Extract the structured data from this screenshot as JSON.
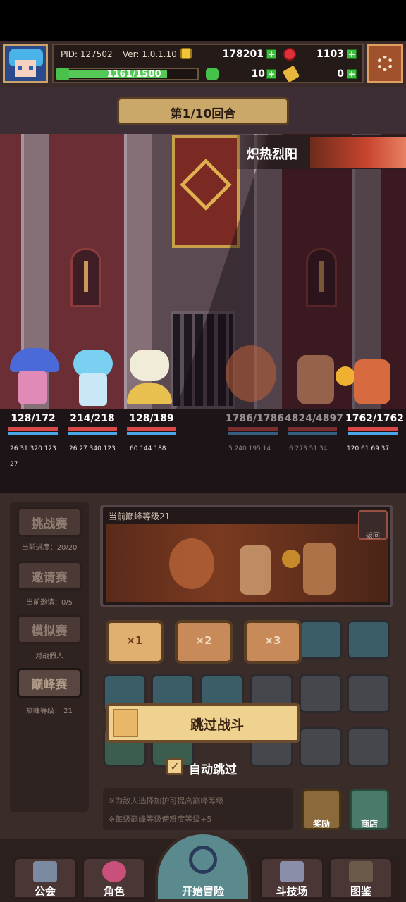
{
  "hud": {
    "pid": "PID: 127502",
    "version": "Ver: 1.0.1.10",
    "gold": "178201",
    "gems": "1103",
    "stamina": "1161/1500",
    "stamina_ratio": 0.774,
    "clover": "10",
    "keys": "0"
  },
  "battle": {
    "round": "第1/10回合",
    "boss_name": "炽热烈阳",
    "heroes": [
      {
        "hp": "128/172",
        "stats": "26 31 320 123",
        "extra": "27"
      },
      {
        "hp": "214/218",
        "stats": "26 27 340 123"
      },
      {
        "hp": "128/189",
        "stats": "60 144 188"
      }
    ],
    "enemies": [
      {
        "hp": "1786/1786",
        "stats": "5 240 195 14"
      },
      {
        "hp": "4824/4897",
        "stats": "6 273 51 34"
      },
      {
        "hp": "1762/1762",
        "stats": "120 61 69 37"
      }
    ]
  },
  "sidebar": {
    "items": [
      {
        "label": "挑战赛",
        "sub": "当前进度：20/20"
      },
      {
        "label": "邀请赛",
        "sub": "当前邀请：0/5"
      },
      {
        "label": "模拟赛",
        "sub": "对战假人"
      },
      {
        "label": "巅峰赛",
        "sub": "巅峰等级： 21"
      }
    ]
  },
  "preview": {
    "title": "当前巅峰等级21",
    "back_label": "返回"
  },
  "speed": [
    "×1",
    "×2",
    "×3"
  ],
  "skip_label": "跳过战斗",
  "auto_skip_label": "自动跳过",
  "auto_skip_checked": "✓",
  "notes": [
    "※为敌人选择加护可提高巅峰等级",
    "※每级巅峰等级使难度等级+5"
  ],
  "side_buttons": {
    "reward": "奖励",
    "shop": "商店"
  },
  "nav": {
    "guild": "公会",
    "character": "角色",
    "adventure": "开始冒险",
    "arena": "斗技场",
    "codex": "图鉴"
  },
  "icons": {
    "settings": "gear-icon",
    "gold": "coin-icon",
    "gem": "ruby-icon",
    "stamina": "stamina-icon",
    "clover": "clover-icon",
    "key": "key-icon"
  }
}
